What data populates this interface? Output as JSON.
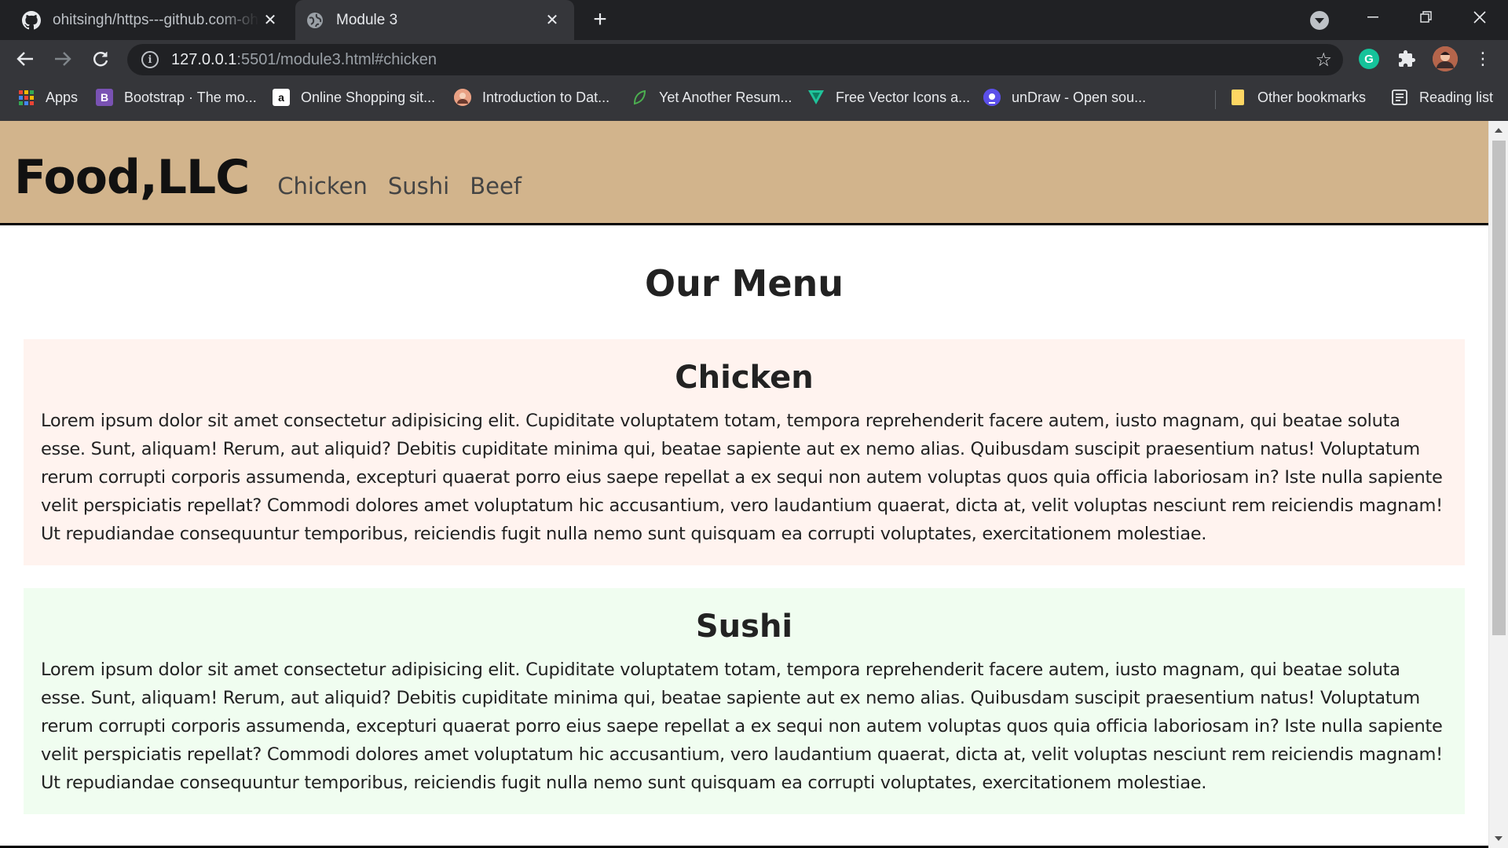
{
  "browser": {
    "tabs": [
      {
        "title": "ohitsingh/https---github.com-ohitsingh",
        "favicon": "github-icon",
        "active": false
      },
      {
        "title": "Module 3",
        "favicon": "globe-icon",
        "active": true
      }
    ],
    "address": {
      "host": "127.0.0.1",
      "rest": ":5501/module3.html#chicken"
    },
    "bookmarks": [
      {
        "label": "Apps",
        "icon": "apps-grid-icon"
      },
      {
        "label": "Bootstrap · The mo...",
        "icon": "bootstrap-icon",
        "color": "#7952b3"
      },
      {
        "label": "Online Shopping sit...",
        "icon": "amazon-icon"
      },
      {
        "label": "Introduction to Dat...",
        "icon": "avatar-icon"
      },
      {
        "label": "Yet Another Resum...",
        "icon": "leaf-icon"
      },
      {
        "label": "Free Vector Icons a...",
        "icon": "vector-icon"
      },
      {
        "label": "unDraw - Open sou...",
        "icon": "undraw-icon"
      },
      {
        "label": "Other bookmarks",
        "icon": "folder-icon"
      },
      {
        "label": "Reading list",
        "icon": "reading-list-icon"
      }
    ]
  },
  "site": {
    "brand": "Food,LLC",
    "nav": [
      "Chicken",
      "Sushi",
      "Beef"
    ],
    "title": "Our Menu",
    "sections": [
      {
        "heading": "Chicken",
        "body": "Lorem ipsum dolor sit amet consectetur adipisicing elit. Cupiditate voluptatem totam, tempora reprehenderit facere autem, iusto magnam, qui beatae soluta esse. Sunt, aliquam! Rerum, aut aliquid? Debitis cupiditate minima qui, beatae sapiente aut ex nemo alias. Quibusdam suscipit praesentium natus! Voluptatum rerum corrupti corporis assumenda, excepturi quaerat porro eius saepe repellat a ex sequi non autem voluptas quos quia officia laboriosam in? Iste nulla sapiente velit perspiciatis repellat? Commodi dolores amet voluptatum hic accusantium, vero laudantium quaerat, dicta at, velit voluptas nesciunt rem reiciendis magnam! Ut repudiandae consequuntur temporibus, reiciendis fugit nulla nemo sunt quisquam ea corrupti voluptates, exercitationem molestiae.",
        "bg": "#fff3ef"
      },
      {
        "heading": "Sushi",
        "body": "Lorem ipsum dolor sit amet consectetur adipisicing elit. Cupiditate voluptatem totam, tempora reprehenderit facere autem, iusto magnam, qui beatae soluta esse. Sunt, aliquam! Rerum, aut aliquid? Debitis cupiditate minima qui, beatae sapiente aut ex nemo alias. Quibusdam suscipit praesentium natus! Voluptatum rerum corrupti corporis assumenda, excepturi quaerat porro eius saepe repellat a ex sequi non autem voluptas quos quia officia laboriosam in? Iste nulla sapiente velit perspiciatis repellat? Commodi dolores amet voluptatum hic accusantium, vero laudantium quaerat, dicta at, velit voluptas nesciunt rem reiciendis magnam! Ut repudiandae consequuntur temporibus, reiciendis fugit nulla nemo sunt quisquam ea corrupti voluptates, exercitationem molestiae.",
        "bg": "#f0fdf0"
      }
    ]
  },
  "colors": {
    "header_bg": "#d2b48c",
    "chrome_dark": "#202124",
    "chrome_toolbar": "#35363a"
  }
}
